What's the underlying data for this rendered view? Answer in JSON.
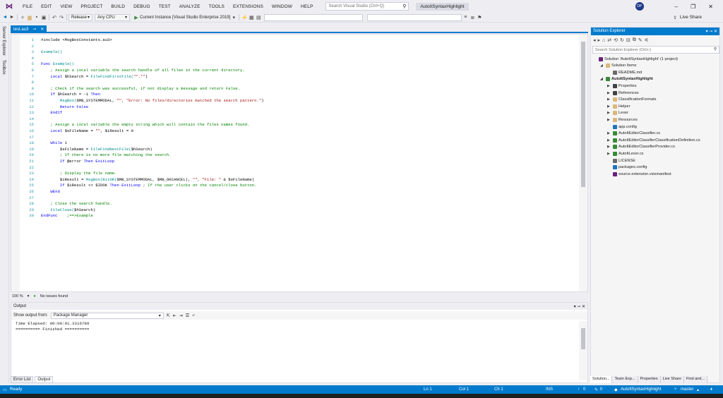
{
  "menubar": {
    "items": [
      "FILE",
      "EDIT",
      "VIEW",
      "PROJECT",
      "BUILD",
      "DEBUG",
      "TEST",
      "ANALYZE",
      "TOOLS",
      "EXTENSIONS",
      "WINDOW",
      "HELP"
    ],
    "search_placeholder": "Search Visual Studio (Ctrl+Q)",
    "solution_name": "AutoItSyntaxHighlight",
    "avatar_initials": "DP"
  },
  "toolbar": {
    "config": "Release",
    "platform": "Any CPU",
    "start_label": "Current Instance [Visual Studio Enterprise 2019]",
    "live_share": "Live Share"
  },
  "left_strip": {
    "server_explorer": "Server Explorer",
    "toolbox": "Toolbox"
  },
  "editor": {
    "tab_label": "test.au3",
    "zoom": "100 %",
    "issues": "No issues found",
    "lines": [
      {
        "n": "1",
        "parts": [
          {
            "t": "#include <MsgBoxConstants.au3>",
            "c": "tx"
          }
        ]
      },
      {
        "n": "2",
        "parts": []
      },
      {
        "n": "3",
        "parts": [
          {
            "t": "Example()",
            "c": "fn"
          }
        ]
      },
      {
        "n": "4",
        "parts": []
      },
      {
        "n": "5",
        "parts": [
          {
            "t": "Func ",
            "c": "kw"
          },
          {
            "t": "Example()",
            "c": "fn"
          }
        ]
      },
      {
        "n": "6",
        "parts": [
          {
            "t": "    ; Assign a Local variable the search handle of all files in the current directory.",
            "c": "cm"
          }
        ]
      },
      {
        "n": "7",
        "parts": [
          {
            "t": "    Local ",
            "c": "kw"
          },
          {
            "t": "$hSearch = ",
            "c": "tx"
          },
          {
            "t": "FileFindFirstFile(",
            "c": "fn"
          },
          {
            "t": "\"*.*\"",
            "c": "st"
          },
          {
            "t": ")",
            "c": "tx"
          }
        ]
      },
      {
        "n": "8",
        "parts": []
      },
      {
        "n": "9",
        "parts": [
          {
            "t": "    ; Check if the search was successful, if not display a message and return False.",
            "c": "cm"
          }
        ]
      },
      {
        "n": "10",
        "parts": [
          {
            "t": "    If ",
            "c": "kw"
          },
          {
            "t": "$hSearch = -1 ",
            "c": "tx"
          },
          {
            "t": "Then",
            "c": "kw"
          }
        ]
      },
      {
        "n": "11",
        "parts": [
          {
            "t": "        ",
            "c": "tx"
          },
          {
            "t": "MsgBox(",
            "c": "fn"
          },
          {
            "t": "$MB_SYSTEMMODAL, ",
            "c": "tx"
          },
          {
            "t": "\"\", \"Error: No files/directories matched the search pattern.\"",
            "c": "st"
          },
          {
            "t": ")",
            "c": "tx"
          }
        ]
      },
      {
        "n": "12",
        "parts": [
          {
            "t": "        Return False",
            "c": "kw"
          }
        ]
      },
      {
        "n": "13",
        "parts": [
          {
            "t": "    EndIf",
            "c": "kw"
          }
        ]
      },
      {
        "n": "14",
        "parts": []
      },
      {
        "n": "15",
        "parts": [
          {
            "t": "    ; Assign a Local variable the empty string which will contain the files names found.",
            "c": "cm"
          }
        ]
      },
      {
        "n": "16",
        "parts": [
          {
            "t": "    Local ",
            "c": "kw"
          },
          {
            "t": "$sFileName = ",
            "c": "tx"
          },
          {
            "t": "\"\"",
            "c": "st"
          },
          {
            "t": ", $iResult = 0",
            "c": "tx"
          }
        ]
      },
      {
        "n": "17",
        "parts": []
      },
      {
        "n": "18",
        "parts": [
          {
            "t": "    While ",
            "c": "kw"
          },
          {
            "t": "1",
            "c": "tx"
          }
        ]
      },
      {
        "n": "19",
        "parts": [
          {
            "t": "        $sFileName = ",
            "c": "tx"
          },
          {
            "t": "FileFindNextFile(",
            "c": "fn"
          },
          {
            "t": "$hSearch)",
            "c": "tx"
          }
        ]
      },
      {
        "n": "20",
        "parts": [
          {
            "t": "        ; If there is no more file matching the search.",
            "c": "cm"
          }
        ]
      },
      {
        "n": "21",
        "parts": [
          {
            "t": "        If ",
            "c": "kw"
          },
          {
            "t": "@error ",
            "c": "tx"
          },
          {
            "t": "Then ExitLoop",
            "c": "kw"
          }
        ]
      },
      {
        "n": "22",
        "parts": []
      },
      {
        "n": "23",
        "parts": [
          {
            "t": "        ; Display the file name.",
            "c": "cm"
          }
        ]
      },
      {
        "n": "24",
        "parts": [
          {
            "t": "        $iResult = ",
            "c": "tx"
          },
          {
            "t": "MsgBox(BitOR(",
            "c": "fn"
          },
          {
            "t": "$MB_SYSTEMMODAL, $MB_OKCANCEL), ",
            "c": "tx"
          },
          {
            "t": "\"\", \"File: \"",
            "c": "st"
          },
          {
            "t": " & $sFileName)",
            "c": "tx"
          }
        ]
      },
      {
        "n": "25",
        "parts": [
          {
            "t": "        If ",
            "c": "kw"
          },
          {
            "t": "$iResult <> $IDOK ",
            "c": "tx"
          },
          {
            "t": "Then ExitLoop ",
            "c": "kw"
          },
          {
            "t": "; If the user clicks on the cancel/close button.",
            "c": "cm"
          }
        ]
      },
      {
        "n": "26",
        "parts": [
          {
            "t": "    WEnd",
            "c": "kw"
          }
        ]
      },
      {
        "n": "27",
        "parts": []
      },
      {
        "n": "28",
        "parts": [
          {
            "t": "    ; Close the search handle.",
            "c": "cm"
          }
        ]
      },
      {
        "n": "29",
        "parts": [
          {
            "t": "    ",
            "c": "tx"
          },
          {
            "t": "FileClose(",
            "c": "fn"
          },
          {
            "t": "$hSearch)",
            "c": "tx"
          }
        ]
      },
      {
        "n": "30",
        "parts": [
          {
            "t": "EndFunc ",
            "c": "kw"
          },
          {
            "t": "   ;==>Example",
            "c": "cm"
          }
        ]
      }
    ]
  },
  "output": {
    "title": "Output",
    "show_from_label": "Show output from:",
    "source": "Package Manager",
    "lines": [
      "Time Elapsed: 00:00:01.3316789",
      "========== Finished =========="
    ],
    "tabs": [
      "Error List",
      "Output"
    ]
  },
  "solution_explorer": {
    "title": "Solution Explorer",
    "search_placeholder": "Search Solution Explorer (Ctrl+;)",
    "items": [
      {
        "label": "Solution 'AutoItSyntaxHighlight' (1 project)",
        "indent": 0,
        "color": "#68217a",
        "bold": false,
        "arrow": ""
      },
      {
        "label": "Solution Items",
        "indent": 1,
        "color": "#dcb67a",
        "bold": false,
        "arrow": "◢"
      },
      {
        "label": "README.md",
        "indent": 2,
        "color": "#6a6a6a",
        "bold": false,
        "arrow": ""
      },
      {
        "label": "AutoItSyntaxHighlight",
        "indent": 1,
        "color": "#388a34",
        "bold": true,
        "arrow": "◢"
      },
      {
        "label": "Properties",
        "indent": 2,
        "color": "#424242",
        "bold": false,
        "arrow": "▶"
      },
      {
        "label": "References",
        "indent": 2,
        "color": "#424242",
        "bold": false,
        "arrow": "▶"
      },
      {
        "label": "ClassificationFormats",
        "indent": 2,
        "color": "#dcb67a",
        "bold": false,
        "arrow": "▶"
      },
      {
        "label": "Helper",
        "indent": 2,
        "color": "#dcb67a",
        "bold": false,
        "arrow": "▶"
      },
      {
        "label": "Lexer",
        "indent": 2,
        "color": "#dcb67a",
        "bold": false,
        "arrow": "▶"
      },
      {
        "label": "Resources",
        "indent": 2,
        "color": "#dcb67a",
        "bold": false,
        "arrow": "▶"
      },
      {
        "label": "app.config",
        "indent": 2,
        "color": "#1e73be",
        "bold": false,
        "arrow": ""
      },
      {
        "label": "AutoItEditorClassifier.cs",
        "indent": 2,
        "color": "#388a34",
        "bold": false,
        "arrow": "▶"
      },
      {
        "label": "AutoItEditorClassifierClassificationDefinition.cs",
        "indent": 2,
        "color": "#388a34",
        "bold": false,
        "arrow": "▶"
      },
      {
        "label": "AutoItEditorClassifierProvider.cs",
        "indent": 2,
        "color": "#388a34",
        "bold": false,
        "arrow": "▶"
      },
      {
        "label": "AutoItLexer.cs",
        "indent": 2,
        "color": "#388a34",
        "bold": false,
        "arrow": "▶"
      },
      {
        "label": "LICENSE",
        "indent": 2,
        "color": "#6a6a6a",
        "bold": false,
        "arrow": ""
      },
      {
        "label": "packages.config",
        "indent": 2,
        "color": "#1e73be",
        "bold": false,
        "arrow": ""
      },
      {
        "label": "source.extension.vsixmanifest",
        "indent": 2,
        "color": "#68217a",
        "bold": false,
        "arrow": ""
      }
    ],
    "bottom_tabs": [
      "Solution...",
      "Team Exp...",
      "Properties",
      "Live Share",
      "Find and..."
    ]
  },
  "statusbar": {
    "ready": "Ready",
    "ln": "Ln 1",
    "col": "Col 1",
    "ch": "Ch 1",
    "ins": "INS",
    "up": "0",
    "pencil": "0",
    "repo": "AutoItSyntaxHighlight",
    "branch": "master"
  },
  "colors": {
    "accent": "#007acc",
    "keyword": "#0000ff",
    "comment": "#008000",
    "function": "#008b8b",
    "string": "#a31515"
  }
}
